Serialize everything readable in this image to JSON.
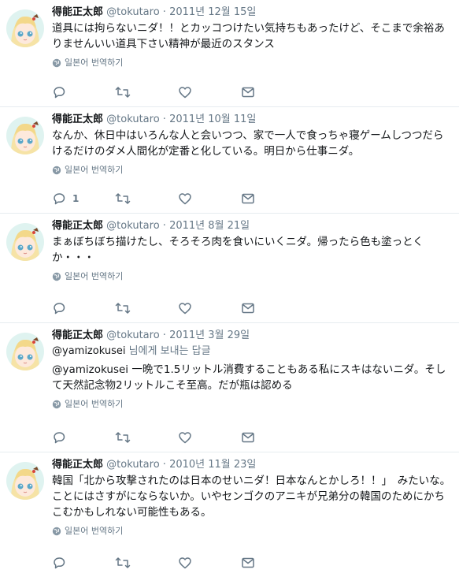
{
  "translate_label": "일본어 번역하기",
  "tweets": [
    {
      "name": "得能正太郎",
      "handle": "@tokutaro",
      "date": "2011년 12월 15일",
      "text": "道具には拘らないニダ！！とカッコつけたい気持ちもあったけど、そこまで余裕ありませんいい道具下さい精神が最近のスタンス",
      "reply_count": ""
    },
    {
      "name": "得能正太郎",
      "handle": "@tokutaro",
      "date": "2011년 10월 11일",
      "text": "なんか、休日中はいろんな人と会いつつ、家で一人で食っちゃ寝ゲームしつつだらけるだけのダメ人間化が定番と化している。明日から仕事ニダ。",
      "reply_count": "1"
    },
    {
      "name": "得能正太郎",
      "handle": "@tokutaro",
      "date": "2011년 8월 21일",
      "text": "まぁぼちぼち描けたし、そろそろ肉を食いにいくニダ。帰ったら色も塗っとくか・・・",
      "reply_count": ""
    },
    {
      "name": "得能正太郎",
      "handle": "@tokutaro",
      "date": "2011년 3월 29일",
      "reply_to_user": "@yamizokusei",
      "reply_to_suffix": " 님에게 보내는 답글",
      "text": "@yamizokusei 一晩で1.5リットル消費することもある私にスキはないニダ。そして天然記念物2リットルこそ至高。だが瓶は認める",
      "reply_count": ""
    },
    {
      "name": "得能正太郎",
      "handle": "@tokutaro",
      "date": "2010년 11월 23일",
      "text": "韓国「北から攻撃されたのは日本のせいニダ！日本なんとかしろ！！」　みたいな。ことにはさすがにならないか。いやセンゴクのアニキが兄弟分の韓国のためにかちこむかもしれない可能性もある。",
      "reply_count": ""
    }
  ]
}
